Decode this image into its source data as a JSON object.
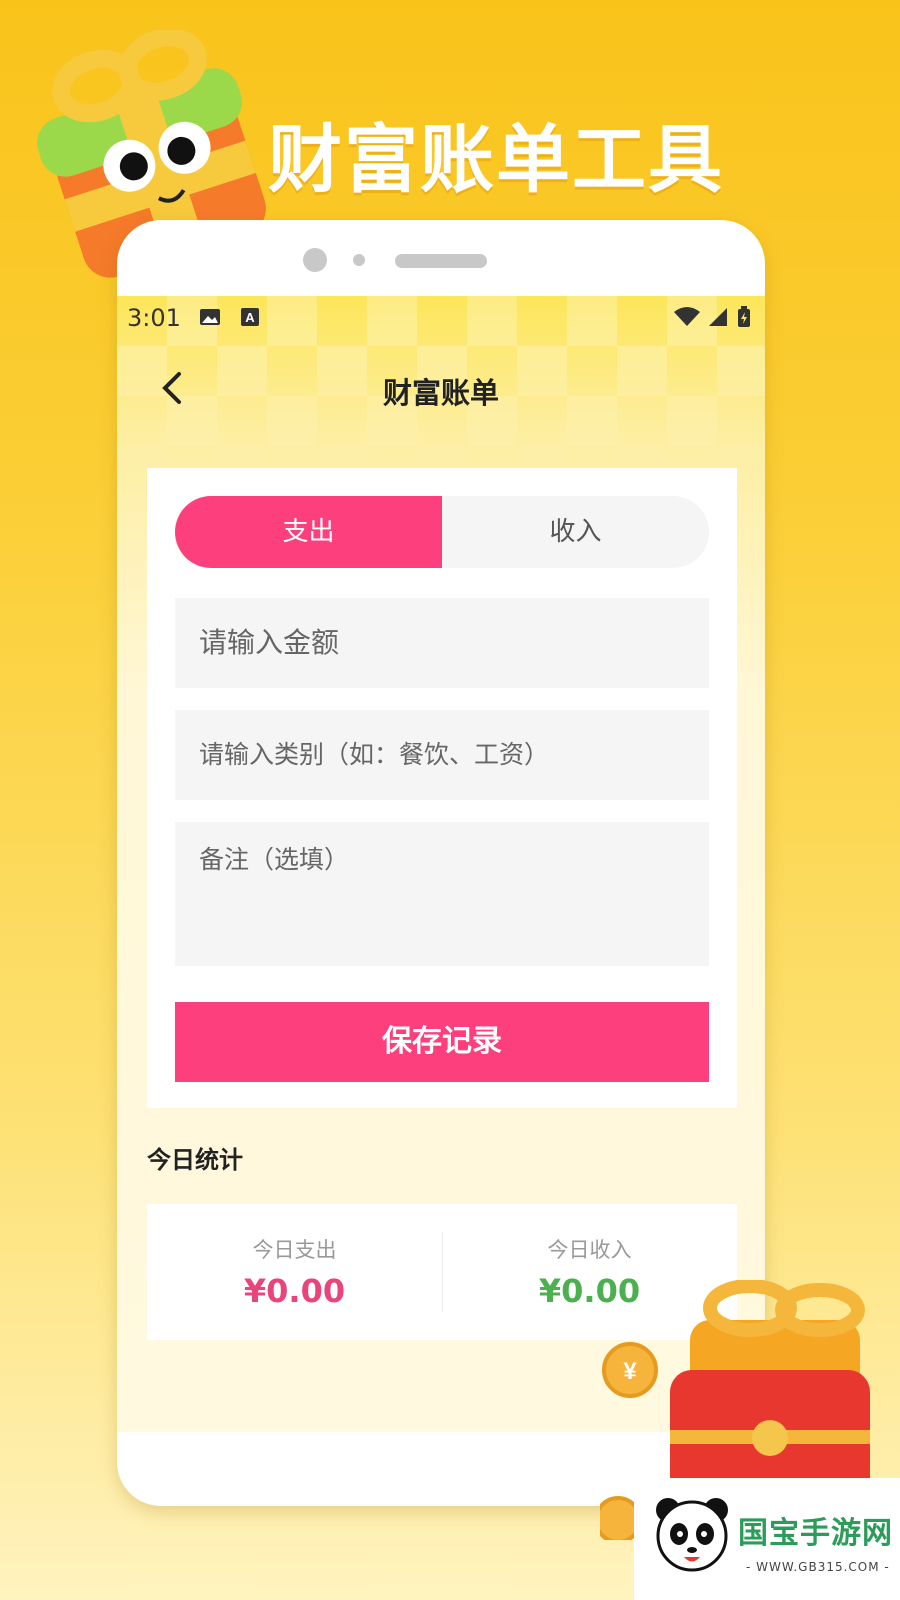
{
  "banner": {
    "title": "财富账单工具"
  },
  "status_bar": {
    "time": "3:01",
    "icons": [
      "image-icon",
      "a-icon",
      "wifi-icon",
      "signal-icon",
      "battery-icon"
    ]
  },
  "nav": {
    "title": "财富账单",
    "back_icon": "chevron-left-icon"
  },
  "form": {
    "tabs": [
      {
        "label": "支出",
        "active": true
      },
      {
        "label": "收入",
        "active": false
      }
    ],
    "amount_placeholder": "请输入金额",
    "category_placeholder": "请输入类别（如：餐饮、工资）",
    "note_placeholder": "备注（选填）",
    "save_label": "保存记录"
  },
  "stats": {
    "heading": "今日统计",
    "expense_label": "今日支出",
    "expense_value": "¥0.00",
    "income_label": "今日收入",
    "income_value": "¥0.00"
  },
  "watermark": {
    "logo_text": "国宝手游网",
    "url": "- WWW.GB315.COM -"
  },
  "colors": {
    "accent": "#fe3f7e",
    "expense": "#e8457c",
    "income": "#4caf50",
    "background": "#fbcb2a"
  }
}
